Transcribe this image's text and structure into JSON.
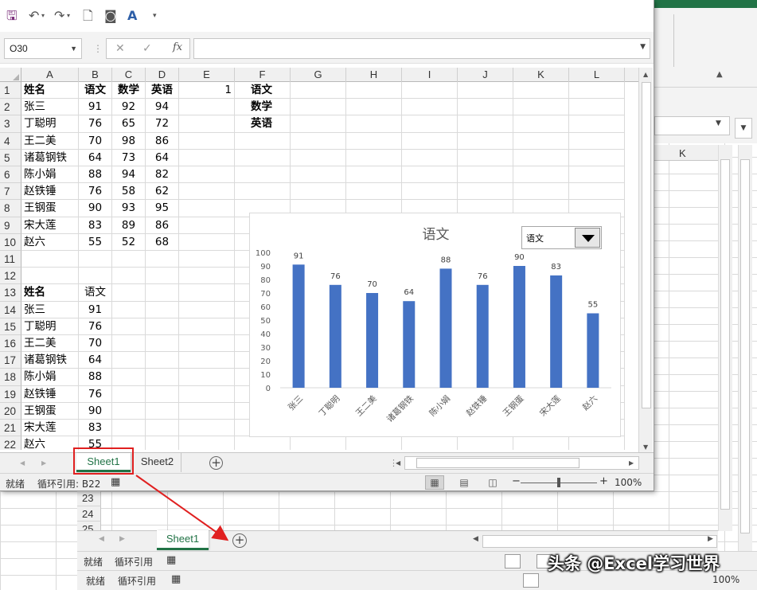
{
  "formula_bar": {
    "name_box": "O30",
    "fx": "fx",
    "formula": ""
  },
  "columns": [
    "A",
    "B",
    "C",
    "D",
    "E",
    "F",
    "G",
    "H",
    "I",
    "J",
    "K",
    "L"
  ],
  "rows": [
    {
      "n": "1",
      "A": "姓名",
      "B": "语文",
      "C": "数学",
      "D": "英语",
      "E": "1",
      "F": "语文"
    },
    {
      "n": "2",
      "A": "张三",
      "B": "91",
      "C": "92",
      "D": "94",
      "F": "数学"
    },
    {
      "n": "3",
      "A": "丁聪明",
      "B": "76",
      "C": "65",
      "D": "72",
      "F": "英语"
    },
    {
      "n": "4",
      "A": "王二美",
      "B": "70",
      "C": "98",
      "D": "86"
    },
    {
      "n": "5",
      "A": "诸葛钢铁",
      "B": "64",
      "C": "73",
      "D": "64"
    },
    {
      "n": "6",
      "A": "陈小娟",
      "B": "88",
      "C": "94",
      "D": "82"
    },
    {
      "n": "7",
      "A": "赵铁锤",
      "B": "76",
      "C": "58",
      "D": "62"
    },
    {
      "n": "8",
      "A": "王钢蛋",
      "B": "90",
      "C": "93",
      "D": "95"
    },
    {
      "n": "9",
      "A": "宋大莲",
      "B": "83",
      "C": "89",
      "D": "86"
    },
    {
      "n": "10",
      "A": "赵六",
      "B": "55",
      "C": "52",
      "D": "68"
    },
    {
      "n": "11"
    },
    {
      "n": "12"
    },
    {
      "n": "13",
      "A": "姓名",
      "B": "语文"
    },
    {
      "n": "14",
      "A": "张三",
      "B": "91"
    },
    {
      "n": "15",
      "A": "丁聪明",
      "B": "76"
    },
    {
      "n": "16",
      "A": "王二美",
      "B": "70"
    },
    {
      "n": "17",
      "A": "诸葛钢铁",
      "B": "64"
    },
    {
      "n": "18",
      "A": "陈小娟",
      "B": "88"
    },
    {
      "n": "19",
      "A": "赵铁锤",
      "B": "76"
    },
    {
      "n": "20",
      "A": "王钢蛋",
      "B": "90"
    },
    {
      "n": "21",
      "A": "宋大莲",
      "B": "83"
    },
    {
      "n": "22",
      "A": "赵六",
      "B": "55"
    }
  ],
  "sheet_tabs": [
    "Sheet1",
    "Sheet2"
  ],
  "status": {
    "ready": "就绪",
    "circular": "循环引用: B22",
    "zoom": "100%"
  },
  "chart_dropdown": {
    "selected": "语文"
  },
  "chart_data": {
    "type": "bar",
    "title": "语文",
    "categories": [
      "张三",
      "丁聪明",
      "王二美",
      "诸葛钢铁",
      "陈小娟",
      "赵铁锤",
      "王钢蛋",
      "宋大莲",
      "赵六"
    ],
    "values": [
      91,
      76,
      70,
      64,
      88,
      76,
      90,
      83,
      55
    ],
    "ylim": [
      0,
      100
    ],
    "yticks": [
      "0",
      "10",
      "20",
      "30",
      "40",
      "50",
      "60",
      "70",
      "80",
      "90",
      "100"
    ],
    "bar_color": "#4472C4",
    "grid": false
  },
  "background": {
    "col_k": "K",
    "rows": [
      "23",
      "24",
      "25"
    ],
    "sheet_tab": "Sheet1",
    "status_ready": "就绪",
    "status_circular": "循环引用",
    "zoom": "100%"
  },
  "watermark": "头条 @Excel学习世界",
  "colors": {
    "excel_green": "#217346",
    "highlight_red": "#E02020"
  }
}
